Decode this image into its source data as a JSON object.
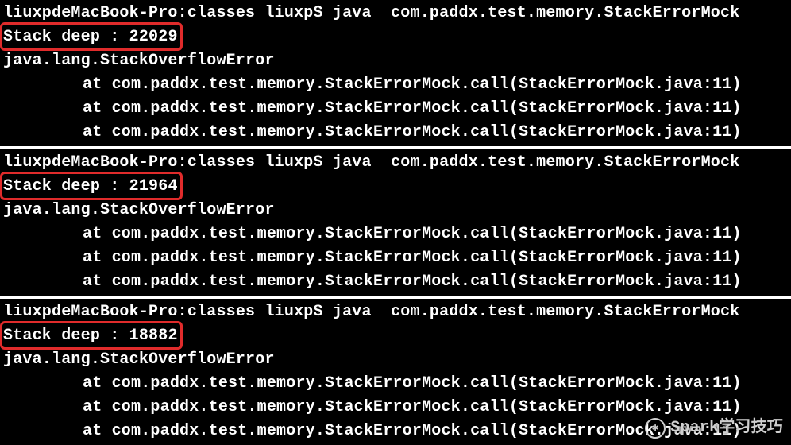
{
  "terminal": {
    "hostname": "liuxpdeMacBook-Pro",
    "dir": "classes",
    "user": "liuxp",
    "prompt_sep": "$",
    "command": "java  com.paddx.test.memory.StackErrorMock"
  },
  "error": {
    "class": "java.lang.StackOverflowError",
    "trace_line": "at com.paddx.test.memory.StackErrorMock.call(StackErrorMock.java:11)"
  },
  "stack_label": "Stack deep :",
  "runs": [
    {
      "depth": "22029"
    },
    {
      "depth": "21964"
    },
    {
      "depth": "18882"
    }
  ],
  "watermark": {
    "icon_glyph": "✱",
    "text": "Spark学习技巧"
  }
}
